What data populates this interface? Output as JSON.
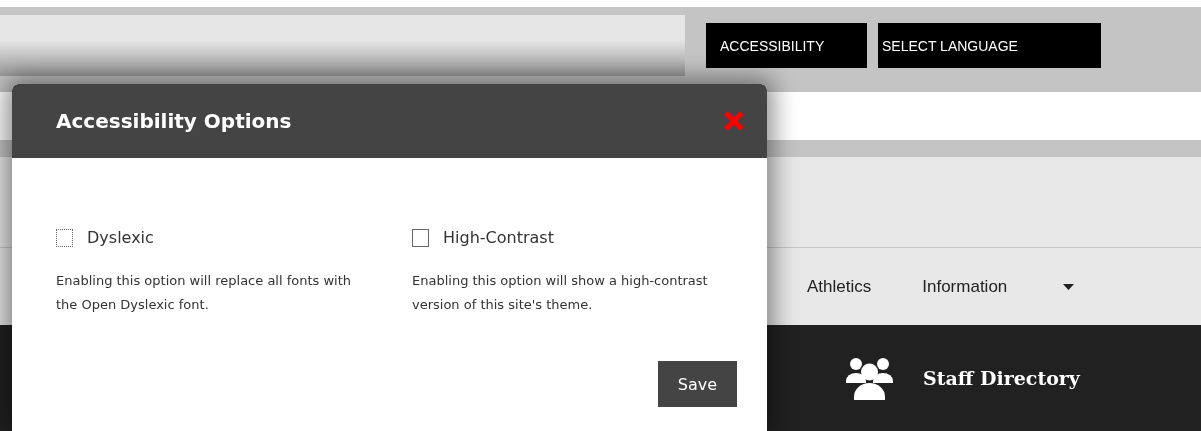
{
  "top_buttons": [
    "ACCESSIBILITY",
    "SELECT LANGUAGE"
  ],
  "nav": {
    "items": [
      "Athletics",
      "Information"
    ],
    "caret": true
  },
  "quick_link": {
    "label": "Staff Directory"
  },
  "modal": {
    "title": "Accessibility Options",
    "options": [
      {
        "label": "Dyslexic",
        "checked": false,
        "description": "Enabling this option will replace all fonts with the Open Dyslexic font."
      },
      {
        "label": "High-Contrast",
        "checked": false,
        "description": "Enabling this option will show a high-contrast version of this site's theme."
      }
    ],
    "save": "Save"
  }
}
